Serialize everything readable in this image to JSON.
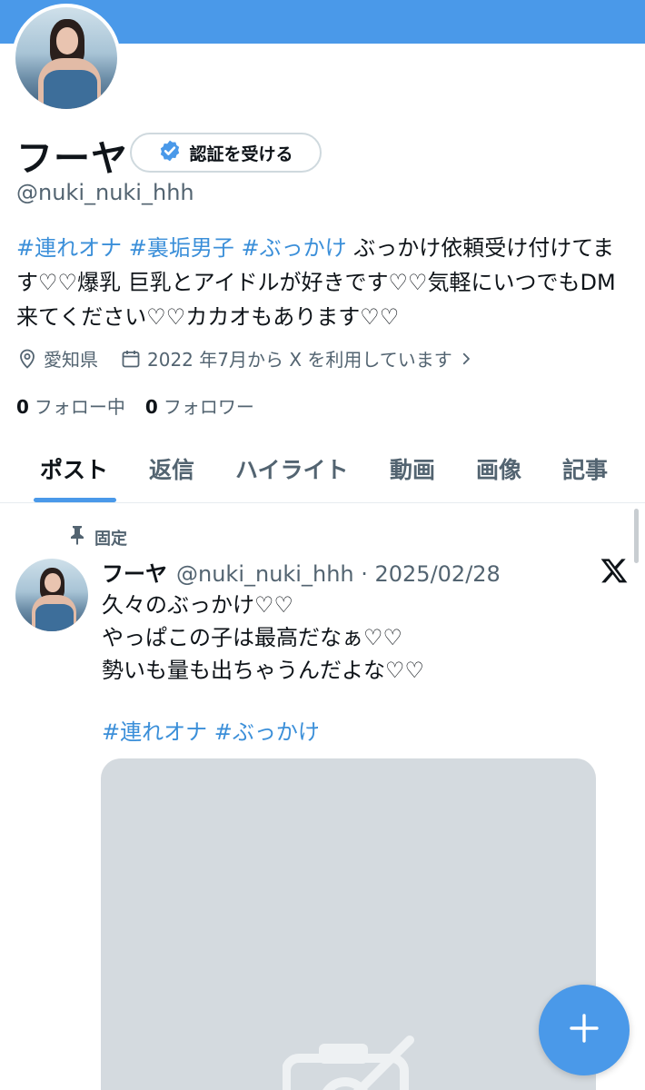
{
  "profile": {
    "name": "フーヤ",
    "verify_label": "認証を受ける",
    "handle": "@nuki_nuki_hhh",
    "bio": {
      "tag1": "#連れオナ",
      "tag2": "#裏垢男子",
      "tag3": "#ぶっかけ",
      "text": " ぶっかけ依頼受け付けてます♡♡爆乳 巨乳とアイドルが好きです♡♡気軽にいつでもDM来てください♡♡カカオもあります♡♡"
    },
    "location": "愛知県",
    "joined": "2022 年7月から X を利用しています",
    "following_count": "0",
    "following_label": "フォロー中",
    "followers_count": "0",
    "followers_label": "フォロワー"
  },
  "tabs": [
    {
      "label": "ポスト"
    },
    {
      "label": "返信"
    },
    {
      "label": "ハイライト"
    },
    {
      "label": "動画"
    },
    {
      "label": "画像"
    },
    {
      "label": "記事"
    }
  ],
  "post": {
    "pinned_label": "固定",
    "name": "フーヤ",
    "handle_date": "@nuki_nuki_hhh · 2025/02/28",
    "lines": [
      "久々のぶっかけ♡♡",
      "やっぱこの子は最高だなぁ♡♡",
      "勢いも量も出ちゃうんだよな♡♡"
    ],
    "tags": "#連れオナ #ぶっかけ"
  },
  "icons": {
    "verify": "verified-badge-icon",
    "location": "location-pin-icon",
    "calendar": "calendar-icon",
    "chevron": "chevron-right-icon",
    "pin": "pin-icon",
    "x_logo": "x-logo-icon",
    "media_placeholder": "camera-off-icon",
    "compose": "plus-icon"
  },
  "colors": {
    "accent": "#4a99e9",
    "link": "#3b8fd9",
    "muted": "#536471"
  }
}
